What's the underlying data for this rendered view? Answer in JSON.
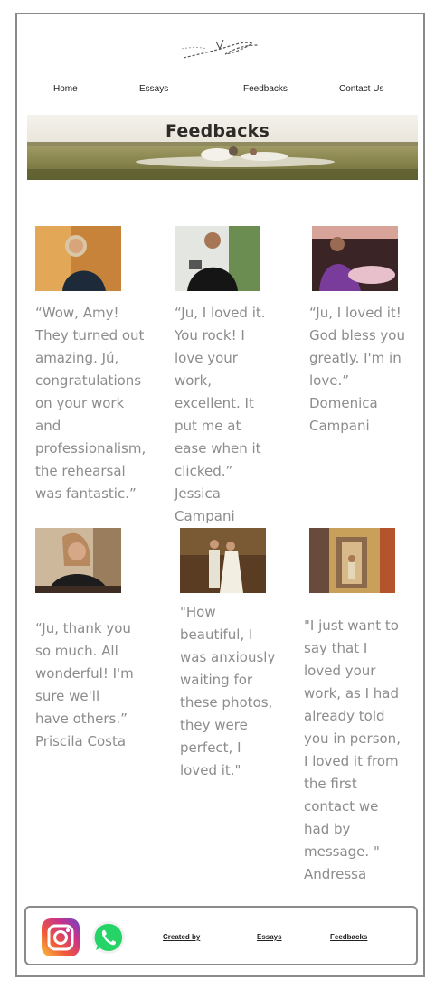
{
  "nav": {
    "items": [
      "Home",
      "Essays",
      "Feedbacks",
      "Contact Us"
    ]
  },
  "banner": {
    "title": "Feedbacks"
  },
  "feedbacks": [
    {
      "quote": "“Wow, Amy! They turned out amazing. Jú, congratulations on your work and professionalism, the rehearsal was fantastic.”",
      "author": ""
    },
    {
      "quote": "“Ju, I loved it. You rock! I love your work, excellent. It put me at ease when it clicked.”",
      "author": "Jessica Campani"
    },
    {
      "quote": "“Ju, I loved it! God bless you greatly. I'm in love.”",
      "author": "Domenica Campani"
    },
    {
      "quote": "“Ju, thank you so much. All wonderful! I'm sure we'll have others.”",
      "author": "Priscila Costa"
    },
    {
      "quote": "\"How beautiful, I was anxiously waiting for these photos, they were perfect, I loved it.\"",
      "author": ""
    },
    {
      "quote": "\"I just want to say that I loved your work, as I had already told you in person, I loved it from the first contact we had by message. \"",
      "author": "Andressa"
    }
  ],
  "footer": {
    "created_by": "Created by",
    "essays": "Essays",
    "feedbacks": "Feedbacks"
  },
  "icons": {
    "instagram": "instagram-icon",
    "whatsapp": "whatsapp-icon"
  },
  "colors": {
    "quote_text": "#8c8c8c",
    "border": "#8a8a8a",
    "whatsapp_green": "#25d366"
  }
}
